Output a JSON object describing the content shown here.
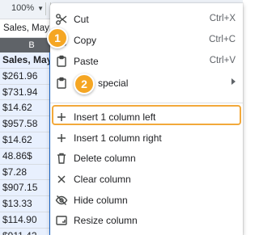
{
  "toolbar": {
    "zoom": "100%"
  },
  "formula_bar": {
    "cell_text": "Sales, May"
  },
  "column": {
    "letter": "B",
    "cells": [
      "Sales, May",
      "$261.96",
      "$731.94",
      "$14.62",
      "$957.58",
      "$14.62",
      "48.86$",
      "$7.28",
      "$907.15",
      "$13.33",
      "$114.90",
      "$911.42"
    ]
  },
  "menu": {
    "items": [
      {
        "icon": "scissors-icon",
        "label": "Cut",
        "shortcut": "Ctrl+X"
      },
      {
        "icon": "copy-icon",
        "label": "Copy",
        "shortcut": "Ctrl+C"
      },
      {
        "icon": "clipboard-icon",
        "label": "Paste",
        "shortcut": "Ctrl+V"
      },
      {
        "icon": "paste-special-icon",
        "label": "Paste special",
        "visible_label": "special"
      },
      {
        "icon": "plus-icon",
        "label": "Insert 1 column left"
      },
      {
        "icon": "plus-icon",
        "label": "Insert 1 column right"
      },
      {
        "icon": "trash-icon",
        "label": "Delete column"
      },
      {
        "icon": "close-icon",
        "label": "Clear column"
      },
      {
        "icon": "eye-off-icon",
        "label": "Hide column"
      },
      {
        "icon": "resize-icon",
        "label": "Resize column"
      }
    ]
  },
  "callouts": {
    "step1": "1",
    "step2": "2"
  },
  "colors": {
    "accent": "#f5a623",
    "selection": "#1a73e8",
    "highlight_border": "#f2a93b"
  }
}
